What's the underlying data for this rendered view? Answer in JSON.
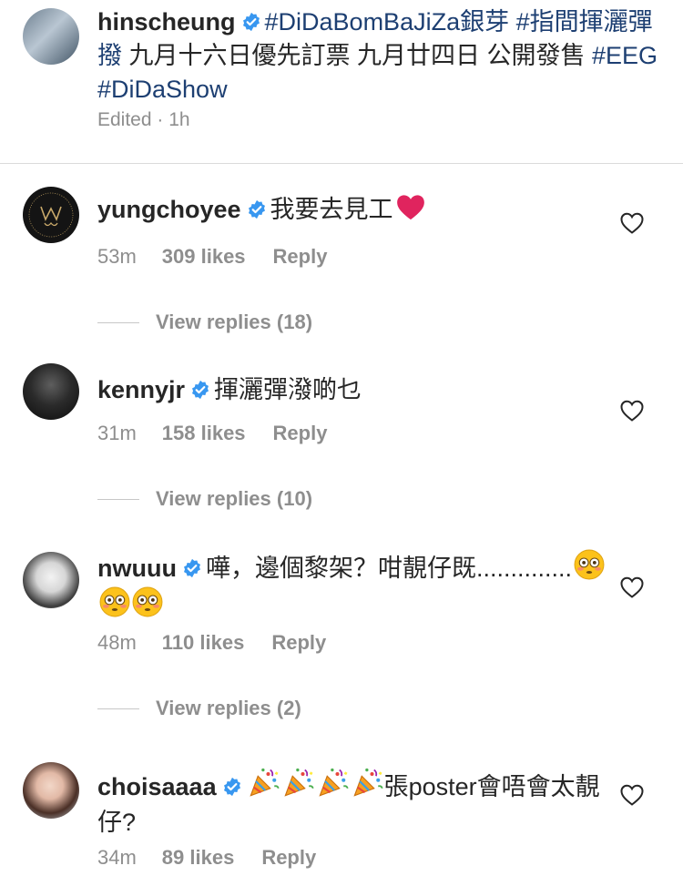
{
  "caption": {
    "username": "hinscheung",
    "segments": [
      {
        "text": "#DiDaBomBaJiZa銀芽",
        "tag": true
      },
      {
        "text": " ",
        "tag": false
      },
      {
        "text": "#指間揮灑彈撥",
        "tag": true
      },
      {
        "text": " 九月十六日優先訂票 九月廿四日 公開發售 ",
        "tag": false
      },
      {
        "text": "#EEG",
        "tag": true
      },
      {
        "text": " ",
        "tag": false
      },
      {
        "text": "#DiDaShow",
        "tag": true
      }
    ],
    "edited": "Edited · 1h"
  },
  "comments": [
    {
      "username": "yungchoyee",
      "text": "我要去見工",
      "emoji_icons": [
        "red-heart-icon"
      ],
      "time": "53m",
      "likes": "309 likes",
      "reply": "Reply",
      "view_replies": "View replies (18)"
    },
    {
      "username": "kennyjr",
      "text": "揮灑彈潑啲乜",
      "emoji_icons": [],
      "time": "31m",
      "likes": "158 likes",
      "reply": "Reply",
      "view_replies": "View replies (10)"
    },
    {
      "username": "nwuuu",
      "text": "嘩，邊個黎架？咁靚仔既..............",
      "emoji_icons": [
        "flushed-face-icon",
        "flushed-face-icon",
        "flushed-face-icon"
      ],
      "time": "48m",
      "likes": "110 likes",
      "reply": "Reply",
      "view_replies": "View replies (2)"
    },
    {
      "username": "choisaaaa",
      "text_prefix_icons": [
        "party-popper-icon",
        "party-popper-icon",
        "party-popper-icon",
        "party-popper-icon"
      ],
      "text": "張poster會唔會太靚仔?",
      "time": "34m",
      "likes": "89 likes",
      "reply": "Reply"
    }
  ],
  "colors": {
    "hashtag": "#1d3f72",
    "verified": "#3897f0",
    "meta": "#8e8e8e",
    "heart_emoji": "#e0245e"
  }
}
